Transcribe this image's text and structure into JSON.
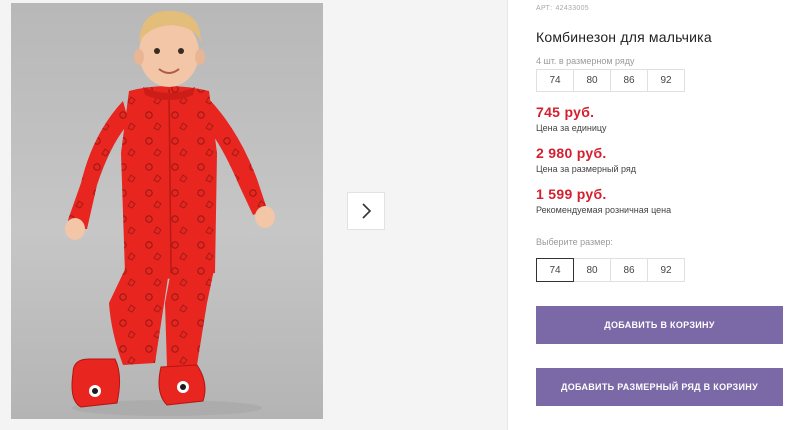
{
  "product": {
    "article_label": "АРТ:",
    "article_number": "42433005",
    "title": "Комбинезон для мальчика",
    "pack_note": "4 шт. в размерном ряду",
    "pack_sizes": [
      "74",
      "80",
      "86",
      "92"
    ],
    "prices": [
      {
        "amount": "745 руб.",
        "caption": "Цена за единицу"
      },
      {
        "amount": "2 980 руб.",
        "caption": "Цена за размерный ряд"
      },
      {
        "amount": "1 599 руб.",
        "caption": "Рекомендуемая розничная цена"
      }
    ],
    "choose_size_label": "Выберите размер:",
    "size_options": [
      "74",
      "80",
      "86",
      "92"
    ],
    "selected_size": "74"
  },
  "buttons": {
    "add_to_cart": "ДОБАВИТЬ В КОРЗИНУ",
    "add_pack_to_cart": "ДОБАВИТЬ РАЗМЕРНЫЙ РЯД В КОРЗИНУ"
  },
  "gallery": {
    "photo_icon": "child-in-red-jumpsuit-photo",
    "next_icon": "chevron-right-icon"
  },
  "colors": {
    "price_red": "#d4202e",
    "button_purple": "#7b68a6",
    "jumpsuit_red": "#e8251f"
  }
}
